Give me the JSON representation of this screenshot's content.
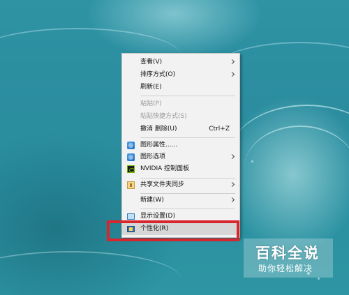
{
  "context_menu": {
    "items": [
      {
        "label": "查看(V)",
        "submenu": true
      },
      {
        "label": "排序方式(O)",
        "submenu": true
      },
      {
        "label": "刷新(E)"
      },
      {
        "label": "粘贴(P)",
        "disabled": true
      },
      {
        "label": "粘贴快捷方式(S)",
        "disabled": true
      },
      {
        "label": "撤消 删除(U)",
        "shortcut": "Ctrl+Z"
      },
      {
        "label": "图形属性......",
        "icon": "graphics-properties-icon"
      },
      {
        "label": "图形选项",
        "icon": "graphics-options-icon",
        "submenu": true
      },
      {
        "label": "NVIDIA 控制面板",
        "icon": "nvidia-icon"
      },
      {
        "label": "共享文件夹同步",
        "icon": "shared-folder-sync-icon",
        "submenu": true
      },
      {
        "label": "新建(W)",
        "submenu": true
      },
      {
        "label": "显示设置(D)",
        "icon": "display-settings-icon"
      },
      {
        "label": "个性化(R)",
        "icon": "personalize-icon",
        "highlighted": true
      }
    ]
  },
  "highlight_color": "#d7262e",
  "watermark": {
    "title": "百科全说",
    "subtitle": "助你轻松解决"
  }
}
